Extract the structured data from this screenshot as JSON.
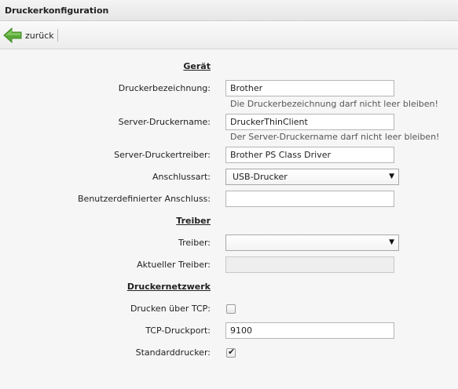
{
  "window": {
    "title": "Druckerkonfiguration"
  },
  "toolbar": {
    "back_label": "zurück"
  },
  "sections": {
    "device": "Gerät",
    "driver": "Treiber",
    "network": "Druckernetzwerk"
  },
  "fields": {
    "printer_name": {
      "label": "Druckerbezeichnung:",
      "value": "Brother",
      "hint": "Die Druckerbezeichnung darf nicht leer bleiben!"
    },
    "server_printer_name": {
      "label": "Server-Druckername:",
      "value": "DruckerThinClient",
      "hint": "Der Server-Druckername darf nicht leer bleiben!"
    },
    "server_printer_driver": {
      "label": "Server-Druckertreiber:",
      "value": "Brother PS Class Driver"
    },
    "connection_type": {
      "label": "Anschlussart:",
      "selected": "USB-Drucker"
    },
    "custom_connection": {
      "label": "Benutzerdefinierter Anschluss:",
      "value": ""
    },
    "driver": {
      "label": "Treiber:",
      "selected": ""
    },
    "current_driver": {
      "label": "Aktueller Treiber:",
      "value": ""
    },
    "print_over_tcp": {
      "label": "Drucken über TCP:",
      "checked": false
    },
    "tcp_port": {
      "label": "TCP-Druckport:",
      "value": "9100"
    },
    "default_printer": {
      "label": "Standarddrucker:",
      "checked": true
    }
  },
  "icons": {
    "back": "arrow-left-icon",
    "dropdown": "dropdown-arrow-icon",
    "check": "checkmark-icon"
  },
  "colors": {
    "back_arrow": "#5aa83a",
    "background": "#f6f6f6"
  }
}
